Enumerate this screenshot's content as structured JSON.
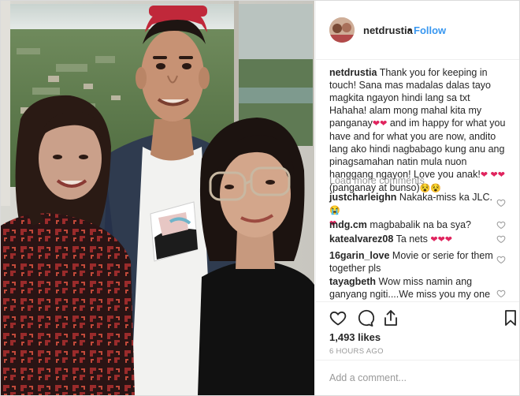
{
  "header": {
    "username": "netdrustia",
    "separator": "•",
    "follow_label": "Follow"
  },
  "caption": {
    "username": "netdrustia",
    "text1": "Thank you for keeping in touch! Sana mas madalas dalas tayo magkita ngayon hindi lang sa txt Hahaha! alam mong mahal kita my panganay",
    "text2": "and im happy for what you have and for what you are now, andito lang ako hindi nagbabago kung anu ang pinagsamahan natin mula nuon hanggang ngayon! Love you anak!",
    "text3": "(panganay at bunso)",
    "hearts_a": "❤❤",
    "hearts_b": "❤",
    "hearts_c": "❤❤",
    "emojis": "😵😵"
  },
  "load_more_label": "Load more comments",
  "comments": [
    {
      "username": "justcharleighn",
      "text": "Nakaka-miss ka JLC.",
      "emoji": "😭",
      "heart": "❤"
    },
    {
      "username": "mdg.cm",
      "text": "magbabalik na ba sya?"
    },
    {
      "username": "katealvarez08",
      "text": "Ta nets",
      "hearts": "❤❤❤"
    },
    {
      "username": "16garin_love",
      "text": "Movie or serie for them together pls"
    },
    {
      "username": "tayagbeth",
      "text": "Wow miss namin ang ganyang ngiti....We miss you my one"
    }
  ],
  "actions": {
    "like_icon": "heart-outline-icon",
    "comment_icon": "speech-bubble-icon",
    "share_icon": "share-icon",
    "save_icon": "bookmark-icon"
  },
  "likes": "1,493 likes",
  "timestamp": "6 HOURS AGO",
  "add_comment_placeholder": "Add a comment...",
  "colors": {
    "follow": "#3897f0",
    "heart": "#e0245e",
    "muted": "#999999",
    "text": "#262626"
  }
}
